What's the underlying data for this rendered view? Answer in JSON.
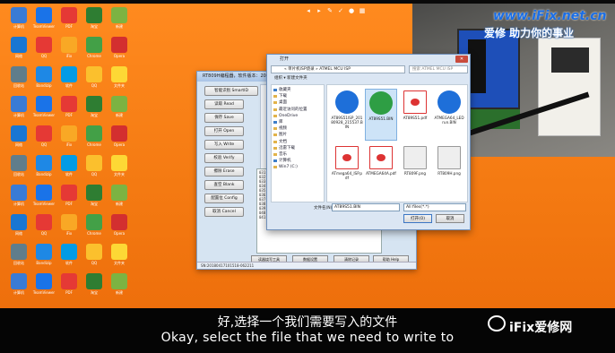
{
  "brand": {
    "url": "www.iFix.net.cn",
    "slogan": "爱修 助力你的事业"
  },
  "desktop_icons": [
    {
      "label": "计算机",
      "color": "#3a7bd5"
    },
    {
      "label": "TeamViewer",
      "color": "#1a73e8"
    },
    {
      "label": "PDF",
      "color": "#e53935"
    },
    {
      "label": "淘宝",
      "color": "#2e7d32"
    },
    {
      "label": "新建",
      "color": "#7cb342"
    },
    {
      "label": "网络",
      "color": "#1976d2"
    },
    {
      "label": "QQ",
      "color": "#e53935"
    },
    {
      "label": "iFix",
      "color": "#f9a825"
    },
    {
      "label": "Chrome",
      "color": "#43a047"
    },
    {
      "label": "Opera",
      "color": "#d32f2f"
    },
    {
      "label": "回收站",
      "color": "#607d8b"
    },
    {
      "label": "Bandizip",
      "color": "#1e88e5"
    },
    {
      "label": "软件",
      "color": "#039be5"
    },
    {
      "label": "QQ",
      "color": "#fbc02d"
    },
    {
      "label": "文件夹",
      "color": "#fdd835"
    }
  ],
  "programmer": {
    "title": "RT809H编程器，软件版本：2018091",
    "buttons": [
      "智能识别 SmartID",
      "读取 Read",
      "保存 Save",
      "打开 Open",
      "写入 Write",
      "校验 Verify",
      "擦除 Erase",
      "查空 Blank",
      "配置位 Config",
      "取消 Cancel"
    ],
    "log": [
      "031 .",
      "032 .",
      "033 .",
      "034 .",
      "035 .",
      "036 .",
      "037 .",
      "038 .",
      "039 .",
      "040 提示:在线编程 [ISP] 下载 ISP...",
      "041 用时: 2.598秒, 实行速度 3462字节/秒"
    ],
    "status": "SN:20180417101518-062211",
    "bottom_buttons": [
      "读器烧写工具",
      "数据设置",
      "清除记录",
      "帮助 Help"
    ]
  },
  "file_dialog": {
    "title": "打开",
    "close": "✕",
    "address": "« 单片机ISP烧录 » ATMEL MCU ISP",
    "search_placeholder": "搜索 ATMEL MCU ISP",
    "commands": "组织 ▾    新建文件夹",
    "nav": [
      {
        "label": "收藏夹",
        "header": true
      },
      {
        "label": "下载",
        "header": false
      },
      {
        "label": "桌面",
        "header": false
      },
      {
        "label": "最近访问的位置",
        "header": false
      },
      {
        "label": "OneDrive",
        "header": false
      },
      {
        "label": "库",
        "header": true
      },
      {
        "label": "视频",
        "header": false
      },
      {
        "label": "图片",
        "header": false
      },
      {
        "label": "文档",
        "header": false
      },
      {
        "label": "迅雷下载",
        "header": false
      },
      {
        "label": "音乐",
        "header": false
      },
      {
        "label": "计算机",
        "header": true
      },
      {
        "label": "Win7 (C:)",
        "header": false
      }
    ],
    "files": [
      {
        "name": "AT89S51ISP_20180928_215537.BIN",
        "kind": "bin",
        "selected": false
      },
      {
        "name": "AT89S51.BIN",
        "kind": "bin",
        "selected": true
      },
      {
        "name": "AT89S51.pdf",
        "kind": "pdf",
        "selected": false
      },
      {
        "name": "ATMEGA64_LED run.BIN",
        "kind": "bin",
        "selected": false
      },
      {
        "name": "ATmega64_ISP.pdf",
        "kind": "pdf",
        "selected": false
      },
      {
        "name": "ATMEGA64A.pdf",
        "kind": "pdf",
        "selected": false
      },
      {
        "name": "RT809F.png",
        "kind": "png",
        "selected": false
      },
      {
        "name": "RT809H.png",
        "kind": "png",
        "selected": false
      }
    ],
    "filename_label": "文件名(N):",
    "filename_value": "AT89S51.BIN",
    "filetype": "All files(*.*)",
    "ok": "打开(O)",
    "cancel": "取消"
  },
  "subtitles": {
    "zh": "好,选择一个我们需要写入的文件",
    "en": "Okay, select the file that we need to write to"
  },
  "watermark": "iFix爱修网",
  "colors": {
    "desktop": "#f47a12",
    "accent": "#1a6ee6",
    "selection": "#cde3f7"
  }
}
